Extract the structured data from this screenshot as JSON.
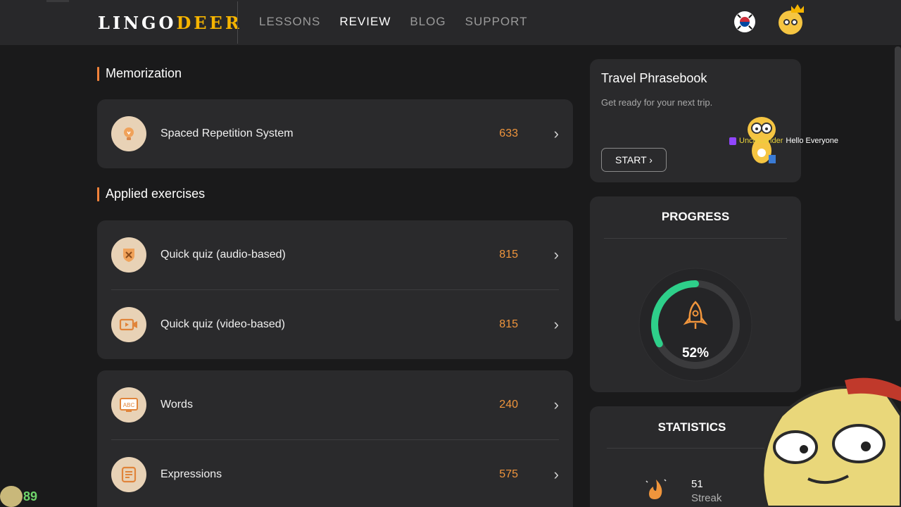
{
  "header": {
    "logo_part1": "LINGO",
    "logo_part2": "DEER",
    "nav": [
      {
        "label": "LESSONS",
        "active": false
      },
      {
        "label": "REVIEW",
        "active": true
      },
      {
        "label": "BLOG",
        "active": false
      },
      {
        "label": "SUPPORT",
        "active": false
      }
    ],
    "language_flag_icon": "korea-flag-icon",
    "avatar_icon": "crowned-deer-avatar-icon"
  },
  "memorization": {
    "title": "Memorization",
    "items": [
      {
        "icon": "lightbulb-icon",
        "label": "Spaced Repetition System",
        "count": "633"
      }
    ]
  },
  "applied": {
    "title": "Applied exercises",
    "items": [
      {
        "icon": "audio-quiz-shield-icon",
        "label": "Quick quiz (audio-based)",
        "count": "815"
      },
      {
        "icon": "video-camera-icon",
        "label": "Quick quiz (video-based)",
        "count": "815"
      }
    ]
  },
  "vocab": {
    "items": [
      {
        "icon": "abc-board-icon",
        "label": "Words",
        "count": "240"
      },
      {
        "icon": "document-lines-icon",
        "label": "Expressions",
        "count": "575"
      }
    ]
  },
  "travel": {
    "title": "Travel Phrasebook",
    "subtitle": "Get ready for your next trip.",
    "button": "START ›"
  },
  "progress": {
    "title": "PROGRESS",
    "percent_value": 52,
    "percent_label": "52%",
    "ring_color": "#2ecf8a"
  },
  "statistics": {
    "title": "STATISTICS",
    "streak_value": "51",
    "streak_label": "Streak"
  },
  "overlay": {
    "chat_user": "UncleLander",
    "chat_message": "Hello Everyone",
    "badge_count": "89"
  },
  "colors": {
    "accent_orange": "#f0823a",
    "count_orange": "#f0953c",
    "card_bg": "#2a2a2c",
    "page_bg": "#1a1a1b"
  }
}
